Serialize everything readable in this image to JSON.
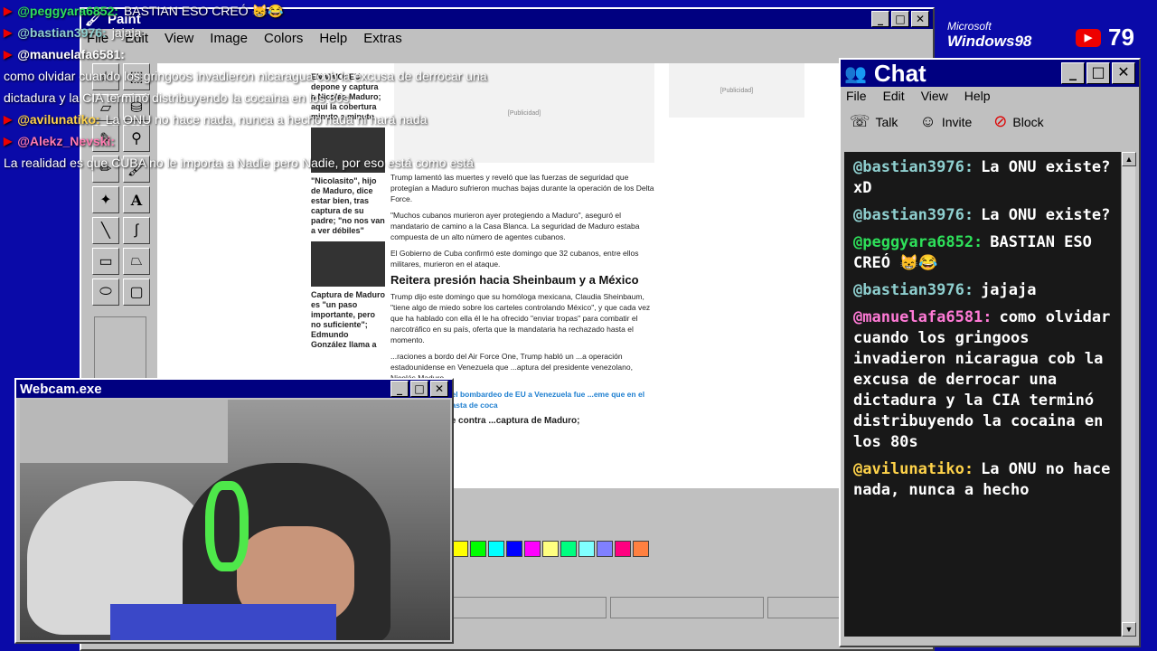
{
  "paint": {
    "title": "Paint",
    "menu": [
      "File",
      "Edit",
      "View",
      "Image",
      "Colors",
      "Help",
      "Extras"
    ]
  },
  "news": {
    "side_top": "EN VIVO: EU depone y captura a Nicolás Maduro; aquí la cobertura minuto a minuto",
    "side_mid": "\"Nicolasito\", hijo de Maduro, dice estar bien, tras captura de su padre; \"no nos van a ver débiles\"",
    "side_bottom": "Captura de Maduro es \"un paso importante, pero no suficiente\"; Edmundo González llama a",
    "ad1": "[Publicidad]",
    "ad2": "[Publicidad]",
    "p1": "Trump lamentó las muertes y reveló que las fuerzas de seguridad que protegían a Maduro sufrieron muchas bajas durante la operación de los Delta Force.",
    "p2": "\"Muchos cubanos murieron ayer protegiendo a Maduro\", aseguró el mandatario de camino a la Casa Blanca. La seguridad de Maduro estaba compuesta de un alto número de agentes cubanos.",
    "p3": "El Gobierno de Cuba confirmó este domingo que 32 cubanos, entre ellos militares, murieron en el ataque.",
    "h1": "Reitera presión hacia Sheinbaum y a México",
    "p4": "Trump dijo este domingo que su homóloga mexicana, Claudia Sheinbaum, \"tiene algo de miedo sobre los carteles controlando México\", y que cada vez que ha hablado con ella él le ha ofrecido \"enviar tropas\" para combatir el narcotráfico en su país, oferta que la mandataria ha rechazado hasta el momento.",
    "p5": "...raciones a bordo del Air Force One, Trump habló un ...a operación estadounidense en Venezuela que ...aptura del presidente venezolano, Nicolás Maduro.",
    "link1": "...tro señaló que el bombardeo de EU a Venezuela fue ...eme que en el sitio se mezcle pasta de coca",
    "link2": "...etro arremete contra ...captura de Maduro;"
  },
  "palette_colors": [
    "#ffff00",
    "#00ff00",
    "#00ffff",
    "#0000ff",
    "#ff00ff",
    "#ffff80",
    "#00ff80",
    "#80ffff",
    "#8080ff",
    "#ff0080",
    "#ff8040"
  ],
  "ticker": [
    {
      "user": "@peggyara6852:",
      "msg": "BASTIAN ESO CREÓ 😸😂",
      "color": "#2ee05a"
    },
    {
      "user": "@bastian3976:",
      "msg": "jajaja",
      "color": "#8fd0d0"
    },
    {
      "user": "@manuelafa6581:",
      "msg": "como olvidar cuando los gringoos invadieron nicaragua cob la excusa de derrocar una dictadura y la CIA terminó distribuyendo la cocaina en los 80s",
      "color": "#ffffff"
    },
    {
      "user": "@avilunatiko:",
      "msg": "La ONU no hace nada, nunca a hecho nada ni hará nada",
      "color": "#ffd34a"
    },
    {
      "user": "@Alekz_Nevski:",
      "msg": "La realidad es que CUBA no le importa a Nadie pero Nadie, por eso está como está",
      "color": "#ff7ab0"
    }
  ],
  "brand": {
    "ms": "Microsoft",
    "w98": "Windows98"
  },
  "viewers": {
    "count": "79"
  },
  "chat": {
    "title": "Chat",
    "menu": [
      "File",
      "Edit",
      "View",
      "Help"
    ],
    "tools": [
      {
        "icon": "☏",
        "label": "Talk"
      },
      {
        "icon": "☺",
        "label": "Invite"
      },
      {
        "icon": "⊘",
        "label": "Block"
      }
    ],
    "messages": [
      {
        "user": "@bastian3976:",
        "msg": "La ONU existe? xD",
        "color": "#8fd0d0"
      },
      {
        "user": "@bastian3976:",
        "msg": "La ONU existe?",
        "color": "#8fd0d0"
      },
      {
        "user": "@peggyara6852:",
        "msg": "BASTIAN ESO CREÓ 😸😂",
        "color": "#2ee05a"
      },
      {
        "user": "@bastian3976:",
        "msg": "jajaja",
        "color": "#8fd0d0"
      },
      {
        "user": "@manuelafa6581:",
        "msg": "como olvidar cuando los gringoos invadieron nicaragua cob la excusa de derrocar una dictadura y la CIA terminó distribuyendo la cocaina en los 80s",
        "color": "#ff7ad6"
      },
      {
        "user": "@avilunatiko:",
        "msg": "La ONU no hace nada, nunca a hecho",
        "color": "#ffd34a"
      }
    ]
  },
  "webcam": {
    "title": "Webcam.exe"
  }
}
